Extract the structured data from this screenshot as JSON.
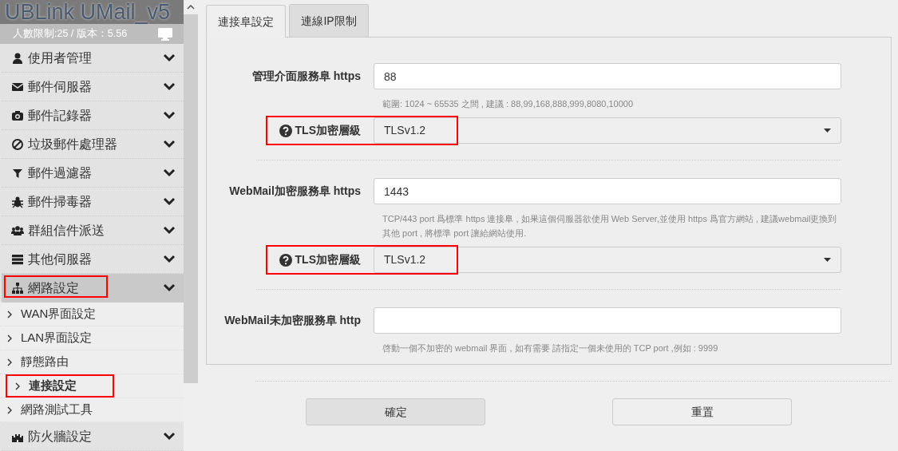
{
  "app": {
    "title": "UBLink UMail_v5",
    "info": "人數限制:25 / 版本：5.56"
  },
  "sidebar": {
    "items": [
      {
        "label": "使用者管理",
        "expanded": false,
        "highlighted": false
      },
      {
        "label": "郵件伺服器",
        "expanded": false,
        "highlighted": false
      },
      {
        "label": "郵件記錄器",
        "expanded": false,
        "highlighted": false
      },
      {
        "label": "垃圾郵件處理器",
        "expanded": false,
        "highlighted": false
      },
      {
        "label": "郵件過濾器",
        "expanded": false,
        "highlighted": false
      },
      {
        "label": "郵件掃毒器",
        "expanded": false,
        "highlighted": false
      },
      {
        "label": "群組信件派送",
        "expanded": false,
        "highlighted": false
      },
      {
        "label": "其他伺服器",
        "expanded": false,
        "highlighted": false
      },
      {
        "label": "網路設定",
        "expanded": true,
        "highlighted": true,
        "children": [
          {
            "label": "WAN界面設定",
            "selected": false,
            "highlighted": false
          },
          {
            "label": "LAN界面設定",
            "selected": false,
            "highlighted": false
          },
          {
            "label": "靜態路由",
            "selected": false,
            "highlighted": false
          },
          {
            "label": "連接設定",
            "selected": true,
            "highlighted": true
          },
          {
            "label": "網路測試工具",
            "selected": false,
            "highlighted": false
          }
        ]
      },
      {
        "label": "防火牆設定",
        "expanded": false,
        "highlighted": false
      }
    ]
  },
  "tabs": [
    {
      "label": "連接阜設定",
      "selected": true
    },
    {
      "label": "連線IP限制",
      "selected": false
    }
  ],
  "form": {
    "rows": [
      {
        "kind": "input",
        "label": "管理介面服務阜 https",
        "value": "88",
        "help": "範圍: 1024 ~ 65535 之間 , 建議 : 88,99,168,888,999,8080,10000"
      },
      {
        "kind": "select",
        "label": "TLS加密層級",
        "value": "TLSv1.2",
        "highlighted": true
      },
      {
        "kind": "input",
        "label": "WebMail加密服務阜 https",
        "value": "1443",
        "help": "TCP/443 port 爲標準 https 連接阜 , 如果這個伺服器欲使用 Web Server,並使用 https 爲官方網站 , 建議webmail更換到其他 port , 將標準 port 讓給網站使用."
      },
      {
        "kind": "select",
        "label": "TLS加密層級",
        "value": "TLSv1.2",
        "highlighted": true
      },
      {
        "kind": "input",
        "label": "WebMail未加密服務阜 http",
        "help": "啓動一個不加密的 webmail 界面 , 如有需要 請指定一個未使用的 TCP port ,例如 : 9999"
      }
    ]
  },
  "buttons": [
    {
      "label": "確定",
      "kind": "submit"
    },
    {
      "label": "重置",
      "kind": "reset"
    }
  ]
}
